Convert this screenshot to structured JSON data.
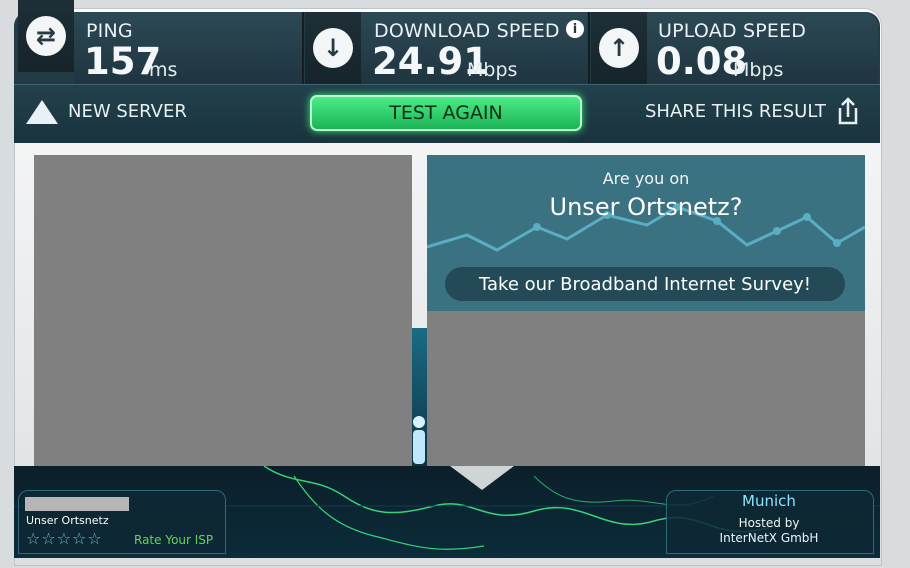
{
  "header": {
    "ping": {
      "label": "PING",
      "value": "157",
      "unit": "ms",
      "icon": "ping-arrows-icon"
    },
    "download": {
      "label": "DOWNLOAD SPEED",
      "value": "24.91",
      "unit": "Mbps",
      "icon": "download-arrow-icon",
      "info": "i"
    },
    "upload": {
      "label": "UPLOAD SPEED",
      "value": "0.08",
      "unit": "Mbps",
      "icon": "upload-arrow-icon"
    }
  },
  "actions": {
    "new_server": "NEW SERVER",
    "test_again": "TEST AGAIN",
    "share": "SHARE THIS RESULT"
  },
  "survey": {
    "line1": "Are you on",
    "line2": "Unser Ortsnetz?",
    "cta": "Take our Broadband Internet Survey!"
  },
  "isp": {
    "name": "Unser Ortsnetz",
    "rate_label": "Rate Your ISP",
    "stars": "☆☆☆☆☆"
  },
  "server": {
    "city": "Munich",
    "hosted_label": "Hosted by",
    "host": "InterNetX GmbH"
  },
  "colors": {
    "accent_green": "#2fd36b",
    "panel_dark": "#233b45",
    "survey_bg": "#3b7282"
  }
}
